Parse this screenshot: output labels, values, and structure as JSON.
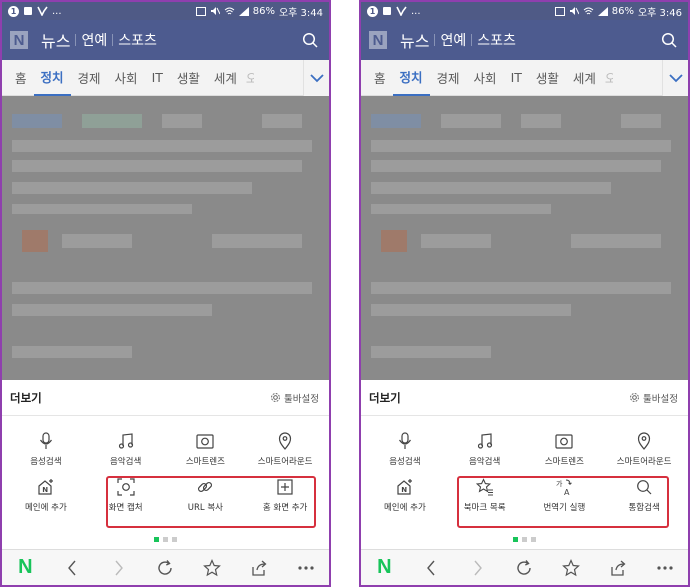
{
  "screens": [
    {
      "status": {
        "badge": "1",
        "battery": "86%",
        "time": "오후 3:44"
      },
      "header": {
        "logo": "N",
        "tabs": [
          "뉴스",
          "연예",
          "스포츠"
        ]
      },
      "categories": [
        "홈",
        "정치",
        "경제",
        "사회",
        "IT",
        "생활",
        "세계",
        "오"
      ],
      "active_category": "정치",
      "sheet": {
        "title": "더보기",
        "settings_label": "툴바설정",
        "row1": [
          {
            "label": "음성검색",
            "icon": "mic-icon"
          },
          {
            "label": "음악검색",
            "icon": "music-note-icon"
          },
          {
            "label": "스마트렌즈",
            "icon": "lens-icon"
          },
          {
            "label": "스마트어라운드",
            "icon": "location-pin-icon"
          }
        ],
        "row2": [
          {
            "label": "메인에 추가",
            "icon": "home-add-icon"
          },
          {
            "label": "화면 캡처",
            "icon": "screen-capture-icon"
          },
          {
            "label": "URL 복사",
            "icon": "link-icon"
          },
          {
            "label": "홈 화면 추가",
            "icon": "plus-box-icon"
          }
        ]
      },
      "bottom_nav": [
        "naver-home-icon",
        "back-icon",
        "forward-icon",
        "refresh-icon",
        "star-icon",
        "share-icon",
        "more-icon"
      ]
    },
    {
      "status": {
        "badge": "1",
        "battery": "86%",
        "time": "오후 3:46"
      },
      "header": {
        "logo": "N",
        "tabs": [
          "뉴스",
          "연예",
          "스포츠"
        ]
      },
      "categories": [
        "홈",
        "정치",
        "경제",
        "사회",
        "IT",
        "생활",
        "세계",
        "오"
      ],
      "active_category": "정치",
      "sheet": {
        "title": "더보기",
        "settings_label": "툴바설정",
        "row1": [
          {
            "label": "음성검색",
            "icon": "mic-icon"
          },
          {
            "label": "음악검색",
            "icon": "music-note-icon"
          },
          {
            "label": "스마트렌즈",
            "icon": "lens-icon"
          },
          {
            "label": "스마트어라운드",
            "icon": "location-pin-icon"
          }
        ],
        "row2": [
          {
            "label": "메인에 추가",
            "icon": "home-add-icon"
          },
          {
            "label": "북마크 목록",
            "icon": "bookmark-list-icon"
          },
          {
            "label": "번역기 실행",
            "icon": "translate-icon"
          },
          {
            "label": "통합검색",
            "icon": "search-icon"
          }
        ]
      },
      "bottom_nav": [
        "naver-home-icon",
        "back-icon",
        "forward-icon",
        "refresh-icon",
        "star-icon",
        "share-icon",
        "more-icon"
      ]
    }
  ]
}
